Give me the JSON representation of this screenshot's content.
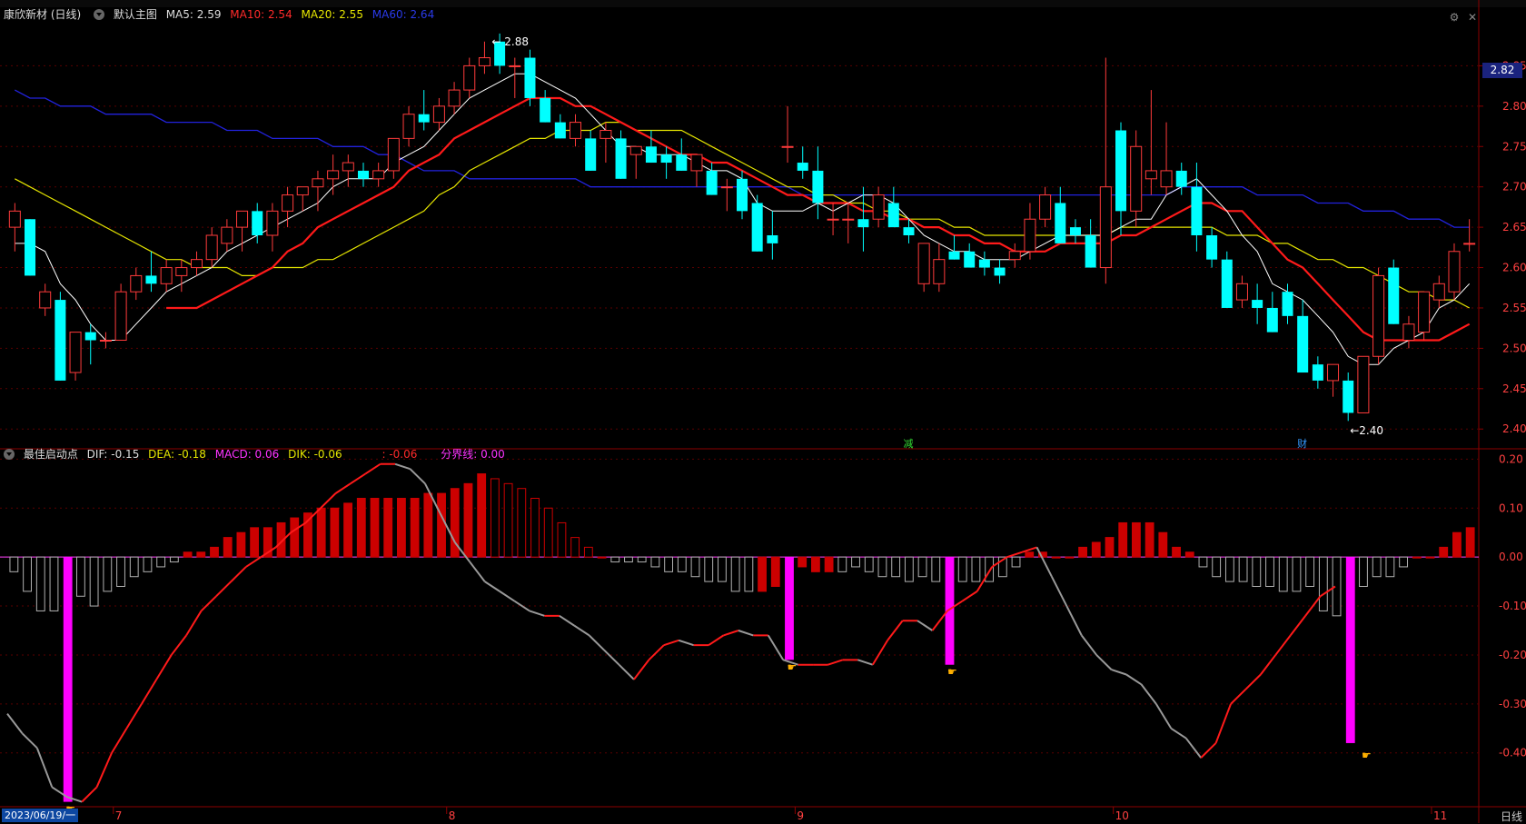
{
  "main": {
    "stock_title": "康欣新材 (日线)",
    "chart_name": "默认主图",
    "ma5": "MA5: 2.59",
    "ma10": "MA10: 2.54",
    "ma20": "MA20: 2.55",
    "ma60": "MA60: 2.64",
    "current_price": "2.82",
    "high_label": "2.88",
    "low_label": "2.40",
    "marker_jian": "减",
    "marker_cai": "财"
  },
  "indicator": {
    "name": "最佳启动点",
    "dif": "DIF: -0.15",
    "dea": "DEA: -0.18",
    "macd": "MACD: 0.06",
    "dik": "DIK: -0.06",
    "extra": ": -0.06",
    "divider": "分界线: 0.00"
  },
  "axis": {
    "price_ticks": [
      "2.85",
      "2.80",
      "2.75",
      "2.70",
      "2.65",
      "2.60",
      "2.55",
      "2.50",
      "2.45",
      "2.40"
    ],
    "ind_ticks": [
      "0.20",
      "0.10",
      "0.00",
      "-0.10",
      "-0.20",
      "-0.30",
      "-0.40"
    ],
    "months": [
      "7",
      "8",
      "9",
      "10",
      "11"
    ],
    "cursor_date": "2023/06/19/一",
    "period": "日线"
  },
  "colors": {
    "up": "#ff3b3b",
    "down": "#00ffff",
    "ma5": "#ffffff",
    "ma10": "#ff1a1a",
    "ma20": "#e6e600",
    "ma60": "#2222dd",
    "macd_pos": "#cc0000",
    "macd_neg": "#b0b0b0",
    "signal": "#ff00ff",
    "grid": "#5a0000"
  },
  "chart_data": {
    "type": "candlestick",
    "ohlc": [
      [
        2.65,
        2.68,
        2.62,
        2.67
      ],
      [
        2.66,
        2.66,
        2.59,
        2.59
      ],
      [
        2.55,
        2.58,
        2.54,
        2.57
      ],
      [
        2.56,
        2.57,
        2.46,
        2.46
      ],
      [
        2.47,
        2.52,
        2.46,
        2.52
      ],
      [
        2.52,
        2.53,
        2.48,
        2.51
      ],
      [
        2.51,
        2.52,
        2.5,
        2.51
      ],
      [
        2.51,
        2.58,
        2.51,
        2.57
      ],
      [
        2.57,
        2.6,
        2.56,
        2.59
      ],
      [
        2.59,
        2.62,
        2.57,
        2.58
      ],
      [
        2.58,
        2.61,
        2.57,
        2.6
      ],
      [
        2.59,
        2.61,
        2.57,
        2.6
      ],
      [
        2.6,
        2.62,
        2.59,
        2.61
      ],
      [
        2.61,
        2.65,
        2.6,
        2.64
      ],
      [
        2.63,
        2.66,
        2.62,
        2.65
      ],
      [
        2.65,
        2.67,
        2.62,
        2.67
      ],
      [
        2.67,
        2.68,
        2.63,
        2.64
      ],
      [
        2.64,
        2.68,
        2.62,
        2.67
      ],
      [
        2.67,
        2.7,
        2.65,
        2.69
      ],
      [
        2.69,
        2.7,
        2.67,
        2.7
      ],
      [
        2.7,
        2.72,
        2.67,
        2.71
      ],
      [
        2.71,
        2.74,
        2.69,
        2.72
      ],
      [
        2.72,
        2.74,
        2.7,
        2.73
      ],
      [
        2.72,
        2.73,
        2.7,
        2.71
      ],
      [
        2.71,
        2.73,
        2.7,
        2.72
      ],
      [
        2.72,
        2.76,
        2.71,
        2.76
      ],
      [
        2.76,
        2.8,
        2.75,
        2.79
      ],
      [
        2.79,
        2.82,
        2.77,
        2.78
      ],
      [
        2.78,
        2.81,
        2.77,
        2.8
      ],
      [
        2.8,
        2.83,
        2.79,
        2.82
      ],
      [
        2.82,
        2.86,
        2.81,
        2.85
      ],
      [
        2.85,
        2.88,
        2.84,
        2.86
      ],
      [
        2.88,
        2.89,
        2.84,
        2.85
      ],
      [
        2.85,
        2.86,
        2.81,
        2.85
      ],
      [
        2.86,
        2.87,
        2.8,
        2.81
      ],
      [
        2.81,
        2.82,
        2.78,
        2.78
      ],
      [
        2.78,
        2.79,
        2.76,
        2.76
      ],
      [
        2.76,
        2.79,
        2.75,
        2.78
      ],
      [
        2.76,
        2.77,
        2.72,
        2.72
      ],
      [
        2.76,
        2.78,
        2.73,
        2.77
      ],
      [
        2.76,
        2.77,
        2.71,
        2.71
      ],
      [
        2.74,
        2.75,
        2.71,
        2.75
      ],
      [
        2.75,
        2.77,
        2.73,
        2.73
      ],
      [
        2.74,
        2.75,
        2.71,
        2.73
      ],
      [
        2.74,
        2.76,
        2.72,
        2.72
      ],
      [
        2.72,
        2.74,
        2.7,
        2.74
      ],
      [
        2.72,
        2.73,
        2.69,
        2.69
      ],
      [
        2.7,
        2.71,
        2.67,
        2.7
      ],
      [
        2.71,
        2.72,
        2.66,
        2.67
      ],
      [
        2.68,
        2.69,
        2.62,
        2.62
      ],
      [
        2.64,
        2.67,
        2.61,
        2.63
      ],
      [
        2.75,
        2.8,
        2.73,
        2.75
      ],
      [
        2.73,
        2.75,
        2.71,
        2.72
      ],
      [
        2.72,
        2.75,
        2.66,
        2.68
      ],
      [
        2.66,
        2.68,
        2.64,
        2.66
      ],
      [
        2.66,
        2.68,
        2.63,
        2.66
      ],
      [
        2.66,
        2.7,
        2.62,
        2.65
      ],
      [
        2.66,
        2.7,
        2.65,
        2.69
      ],
      [
        2.68,
        2.7,
        2.66,
        2.65
      ],
      [
        2.65,
        2.66,
        2.63,
        2.64
      ],
      [
        2.58,
        2.63,
        2.57,
        2.63
      ],
      [
        2.58,
        2.63,
        2.57,
        2.61
      ],
      [
        2.62,
        2.64,
        2.61,
        2.61
      ],
      [
        2.62,
        2.63,
        2.6,
        2.6
      ],
      [
        2.61,
        2.62,
        2.59,
        2.6
      ],
      [
        2.6,
        2.61,
        2.58,
        2.59
      ],
      [
        2.61,
        2.63,
        2.6,
        2.62
      ],
      [
        2.62,
        2.68,
        2.61,
        2.66
      ],
      [
        2.66,
        2.7,
        2.65,
        2.69
      ],
      [
        2.68,
        2.7,
        2.63,
        2.63
      ],
      [
        2.65,
        2.66,
        2.63,
        2.64
      ],
      [
        2.64,
        2.66,
        2.6,
        2.6
      ],
      [
        2.6,
        2.86,
        2.58,
        2.7
      ],
      [
        2.77,
        2.78,
        2.64,
        2.67
      ],
      [
        2.67,
        2.77,
        2.65,
        2.75
      ],
      [
        2.71,
        2.82,
        2.69,
        2.72
      ],
      [
        2.7,
        2.78,
        2.69,
        2.72
      ],
      [
        2.72,
        2.73,
        2.69,
        2.7
      ],
      [
        2.7,
        2.73,
        2.62,
        2.64
      ],
      [
        2.64,
        2.65,
        2.6,
        2.61
      ],
      [
        2.61,
        2.62,
        2.55,
        2.55
      ],
      [
        2.56,
        2.59,
        2.55,
        2.58
      ],
      [
        2.56,
        2.58,
        2.53,
        2.55
      ],
      [
        2.55,
        2.57,
        2.52,
        2.52
      ],
      [
        2.57,
        2.58,
        2.53,
        2.54
      ],
      [
        2.54,
        2.56,
        2.47,
        2.47
      ],
      [
        2.48,
        2.49,
        2.45,
        2.46
      ],
      [
        2.46,
        2.48,
        2.44,
        2.48
      ],
      [
        2.46,
        2.47,
        2.41,
        2.42
      ],
      [
        2.42,
        2.49,
        2.42,
        2.49
      ],
      [
        2.49,
        2.6,
        2.48,
        2.59
      ],
      [
        2.6,
        2.61,
        2.53,
        2.53
      ],
      [
        2.51,
        2.54,
        2.5,
        2.53
      ],
      [
        2.52,
        2.57,
        2.51,
        2.57
      ],
      [
        2.56,
        2.59,
        2.55,
        2.58
      ],
      [
        2.57,
        2.63,
        2.56,
        2.62
      ],
      [
        2.63,
        2.66,
        2.62,
        2.63
      ]
    ],
    "ma5": [
      2.63,
      2.63,
      2.62,
      2.58,
      2.56,
      2.53,
      2.51,
      2.51,
      2.53,
      2.55,
      2.57,
      2.58,
      2.59,
      2.6,
      2.62,
      2.63,
      2.64,
      2.65,
      2.66,
      2.67,
      2.68,
      2.7,
      2.71,
      2.71,
      2.71,
      2.73,
      2.74,
      2.75,
      2.77,
      2.79,
      2.81,
      2.82,
      2.83,
      2.84,
      2.84,
      2.83,
      2.82,
      2.81,
      2.79,
      2.77,
      2.75,
      2.75,
      2.74,
      2.74,
      2.74,
      2.73,
      2.72,
      2.72,
      2.71,
      2.68,
      2.67,
      2.67,
      2.67,
      2.68,
      2.67,
      2.68,
      2.69,
      2.69,
      2.68,
      2.66,
      2.64,
      2.63,
      2.62,
      2.62,
      2.61,
      2.61,
      2.61,
      2.62,
      2.63,
      2.64,
      2.64,
      2.64,
      2.64,
      2.65,
      2.66,
      2.66,
      2.69,
      2.7,
      2.71,
      2.69,
      2.67,
      2.64,
      2.62,
      2.58,
      2.57,
      2.56,
      2.54,
      2.52,
      2.49,
      2.48,
      2.48,
      2.5,
      2.51,
      2.52,
      2.55,
      2.56,
      2.58,
      2.59
    ],
    "ma10": [
      null,
      null,
      null,
      null,
      null,
      null,
      null,
      null,
      null,
      null,
      2.55,
      2.55,
      2.55,
      2.56,
      2.57,
      2.58,
      2.59,
      2.6,
      2.62,
      2.63,
      2.65,
      2.66,
      2.67,
      2.68,
      2.69,
      2.7,
      2.72,
      2.73,
      2.74,
      2.76,
      2.77,
      2.78,
      2.79,
      2.8,
      2.81,
      2.81,
      2.81,
      2.8,
      2.8,
      2.79,
      2.78,
      2.77,
      2.76,
      2.75,
      2.74,
      2.74,
      2.73,
      2.73,
      2.72,
      2.71,
      2.7,
      2.69,
      2.69,
      2.68,
      2.68,
      2.68,
      2.67,
      2.67,
      2.66,
      2.66,
      2.65,
      2.65,
      2.64,
      2.64,
      2.63,
      2.63,
      2.62,
      2.62,
      2.62,
      2.63,
      2.63,
      2.63,
      2.63,
      2.64,
      2.64,
      2.65,
      2.66,
      2.67,
      2.68,
      2.68,
      2.67,
      2.67,
      2.65,
      2.63,
      2.61,
      2.6,
      2.58,
      2.56,
      2.54,
      2.52,
      2.51,
      2.51,
      2.51,
      2.51,
      2.51,
      2.52,
      2.53,
      2.54
    ],
    "ma20": [
      2.71,
      2.7,
      2.69,
      2.68,
      2.67,
      2.66,
      2.65,
      2.64,
      2.63,
      2.62,
      2.61,
      2.61,
      2.6,
      2.6,
      2.6,
      2.59,
      2.59,
      2.6,
      2.6,
      2.6,
      2.61,
      2.61,
      2.62,
      2.63,
      2.64,
      2.65,
      2.66,
      2.67,
      2.69,
      2.7,
      2.72,
      2.73,
      2.74,
      2.75,
      2.76,
      2.76,
      2.77,
      2.77,
      2.77,
      2.78,
      2.78,
      2.77,
      2.77,
      2.77,
      2.77,
      2.76,
      2.75,
      2.74,
      2.73,
      2.72,
      2.71,
      2.7,
      2.7,
      2.69,
      2.69,
      2.68,
      2.68,
      2.67,
      2.67,
      2.66,
      2.66,
      2.66,
      2.65,
      2.65,
      2.64,
      2.64,
      2.64,
      2.64,
      2.64,
      2.64,
      2.64,
      2.64,
      2.64,
      2.65,
      2.65,
      2.65,
      2.65,
      2.65,
      2.65,
      2.65,
      2.64,
      2.64,
      2.64,
      2.63,
      2.63,
      2.62,
      2.61,
      2.61,
      2.6,
      2.6,
      2.59,
      2.58,
      2.57,
      2.57,
      2.56,
      2.56,
      2.55
    ],
    "ma60": [
      2.82,
      2.81,
      2.81,
      2.8,
      2.8,
      2.8,
      2.79,
      2.79,
      2.79,
      2.79,
      2.78,
      2.78,
      2.78,
      2.78,
      2.77,
      2.77,
      2.77,
      2.76,
      2.76,
      2.76,
      2.76,
      2.75,
      2.75,
      2.75,
      2.74,
      2.74,
      2.73,
      2.72,
      2.72,
      2.72,
      2.71,
      2.71,
      2.71,
      2.71,
      2.71,
      2.71,
      2.71,
      2.71,
      2.7,
      2.7,
      2.7,
      2.7,
      2.7,
      2.7,
      2.7,
      2.7,
      2.7,
      2.7,
      2.7,
      2.7,
      2.7,
      2.7,
      2.69,
      2.69,
      2.69,
      2.69,
      2.69,
      2.69,
      2.69,
      2.69,
      2.69,
      2.69,
      2.69,
      2.69,
      2.69,
      2.69,
      2.69,
      2.69,
      2.69,
      2.69,
      2.69,
      2.69,
      2.69,
      2.69,
      2.69,
      2.69,
      2.69,
      2.7,
      2.7,
      2.7,
      2.7,
      2.7,
      2.69,
      2.69,
      2.69,
      2.69,
      2.68,
      2.68,
      2.68,
      2.67,
      2.67,
      2.67,
      2.66,
      2.66,
      2.66,
      2.65,
      2.65,
      2.64
    ],
    "macd": [
      -0.03,
      -0.07,
      -0.11,
      -0.11,
      -0.5,
      -0.08,
      -0.1,
      -0.07,
      -0.06,
      -0.04,
      -0.03,
      -0.02,
      -0.01,
      0.01,
      0.01,
      0.02,
      0.04,
      0.05,
      0.06,
      0.06,
      0.07,
      0.08,
      0.09,
      0.1,
      0.1,
      0.11,
      0.12,
      0.12,
      0.12,
      0.12,
      0.12,
      0.13,
      0.13,
      0.14,
      0.15,
      0.17,
      0.16,
      0.15,
      0.14,
      0.12,
      0.1,
      0.07,
      0.04,
      0.02,
      0.0,
      -0.01,
      -0.01,
      -0.01,
      -0.02,
      -0.03,
      -0.03,
      -0.04,
      -0.05,
      -0.05,
      -0.07,
      -0.07,
      -0.07,
      -0.06,
      -0.21,
      -0.02,
      -0.03,
      -0.03,
      -0.03,
      -0.02,
      -0.03,
      -0.04,
      -0.04,
      -0.05,
      -0.04,
      -0.05,
      -0.22,
      -0.05,
      -0.05,
      -0.05,
      -0.04,
      -0.02,
      0.01,
      0.01,
      0.0,
      0.0,
      0.02,
      0.03,
      0.04,
      0.07,
      0.07,
      0.07,
      0.05,
      0.02,
      0.01,
      -0.02,
      -0.04,
      -0.05,
      -0.05,
      -0.06,
      -0.06,
      -0.07,
      -0.07,
      -0.06,
      -0.11,
      -0.12,
      -0.38,
      -0.06,
      -0.04,
      -0.04,
      -0.02,
      0.0,
      0.0,
      0.02,
      0.05,
      0.06
    ],
    "dif": [
      -0.32,
      -0.36,
      -0.39,
      -0.47,
      -0.49,
      -0.5,
      -0.47,
      -0.4,
      -0.35,
      -0.3,
      -0.25,
      -0.2,
      -0.16,
      -0.11,
      -0.08,
      -0.05,
      -0.02,
      0.0,
      0.02,
      0.05,
      0.07,
      0.1,
      0.13,
      0.15,
      0.17,
      0.19,
      0.19,
      0.18,
      0.15,
      0.09,
      0.03,
      -0.01,
      -0.05,
      -0.07,
      -0.09,
      -0.11,
      -0.12,
      -0.12,
      -0.14,
      -0.16,
      -0.19,
      -0.22,
      -0.25,
      -0.21,
      -0.18,
      -0.17,
      -0.18,
      -0.18,
      -0.16,
      -0.15,
      -0.16,
      -0.16,
      -0.21,
      -0.22,
      -0.22,
      -0.22,
      -0.21,
      -0.21,
      -0.22,
      -0.17,
      -0.13,
      -0.13,
      -0.15,
      -0.11,
      -0.09,
      -0.07,
      -0.02,
      0.0,
      0.01,
      0.02,
      -0.04,
      -0.1,
      -0.16,
      -0.2,
      -0.23,
      -0.24,
      -0.26,
      -0.3,
      -0.35,
      -0.37,
      -0.41,
      -0.38,
      -0.3,
      -0.27,
      -0.24,
      -0.2,
      -0.16,
      -0.12,
      -0.08,
      -0.06
    ],
    "dif_x": [
      0,
      1,
      2,
      3,
      4,
      5,
      6,
      7,
      8,
      9,
      10,
      11,
      12,
      13,
      14,
      15,
      16,
      17,
      18,
      19,
      20,
      21,
      22,
      23,
      24,
      25,
      26,
      27,
      28,
      29,
      30,
      31,
      32,
      33,
      34,
      35,
      36,
      37,
      38,
      39,
      40,
      41,
      42,
      43,
      44,
      45,
      46,
      47,
      48,
      49,
      50,
      51,
      52,
      53,
      54,
      55,
      56,
      57,
      58,
      59,
      60,
      61,
      62,
      63,
      64,
      65,
      66,
      67,
      68,
      69,
      70,
      71,
      72,
      73,
      74,
      75,
      76,
      77,
      78,
      79,
      80,
      81,
      82,
      83,
      84,
      85,
      86,
      87,
      88,
      89
    ],
    "price_range": [
      2.38,
      2.9
    ],
    "ind_range": [
      -0.51,
      0.21
    ]
  }
}
